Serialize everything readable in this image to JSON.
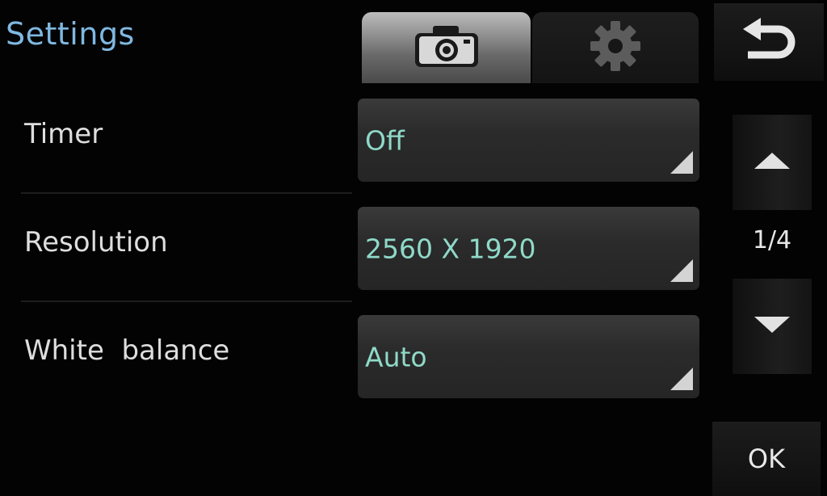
{
  "header": {
    "title": "Settings"
  },
  "tabs": [
    {
      "icon": "camera-icon",
      "active": true
    },
    {
      "icon": "gear-icon",
      "active": false
    }
  ],
  "nav": {
    "back_icon": "return-arrow-icon",
    "scroll_up_icon": "triangle-up-icon",
    "scroll_down_icon": "triangle-down-icon",
    "page_indicator": "1/4",
    "ok_label": "OK"
  },
  "settings": [
    {
      "label": "Timer",
      "value": "Off"
    },
    {
      "label": "Resolution",
      "value": "2560 X 1920"
    },
    {
      "label": "White  balance",
      "value": "Auto"
    }
  ],
  "colors": {
    "title": "#7fb8e0",
    "value_text": "#8fd9c8",
    "background": "#030303"
  }
}
